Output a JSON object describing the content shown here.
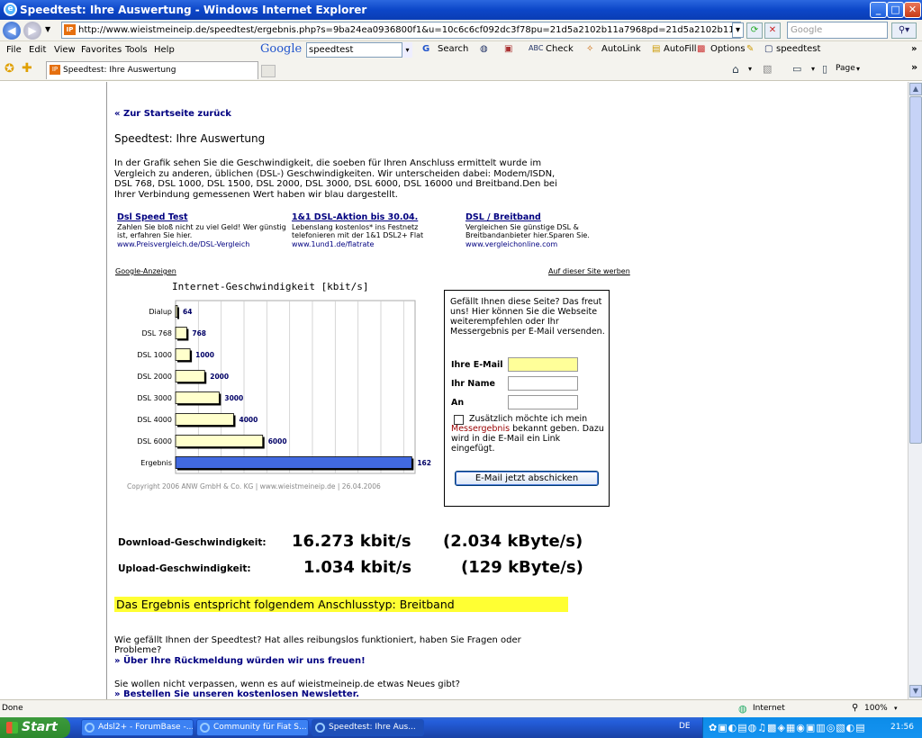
{
  "window": {
    "title": "Speedtest: Ihre Auswertung - Windows Internet Explorer"
  },
  "address": {
    "url": "http://www.wieistmeineip.de/speedtest/ergebnis.php?s=9ba24ea0936800f1&u=10c6c6cf092dc3f78pu=21d5a2102b11a7968pd=21d5a2102b11a796",
    "search_placeholder": "Google"
  },
  "menu": [
    "File",
    "Edit",
    "View",
    "Favorites",
    "Tools",
    "Help"
  ],
  "google_toolbar": {
    "logo": "Google",
    "query": "speedtest",
    "search": "Search",
    "check": "Check",
    "autolink": "AutoLink",
    "autofill": "AutoFill",
    "options": "Options",
    "bookmark": "speedtest"
  },
  "tab": {
    "title": "Speedtest: Ihre Auswertung"
  },
  "commandbar": {
    "page": "Page"
  },
  "page": {
    "back_link": "« Zur Startseite zurück",
    "heading": "Speedtest: Ihre Auswertung",
    "intro": "In der Grafik sehen Sie die Geschwindigkeit, die soeben für Ihren Anschluss ermittelt wurde im Vergleich zu anderen, üblichen (DSL-) Geschwindigkeiten. Wir unterscheiden dabei: Modem/ISDN, DSL 768, DSL 1000, DSL 1500, DSL 2000, DSL 3000, DSL 6000, DSL 16000 und Breitband.Den bei Ihrer Verbindung gemessenen Wert haben wir blau dargestellt.",
    "ads": [
      {
        "title": "Dsl Speed Test",
        "text": "Zahlen Sie bloß nicht zu viel Geld! Wer günstig ist, erfahren Sie hier.",
        "url": "www.Preisvergleich.de/DSL-Vergleich"
      },
      {
        "title": "1&1 DSL-Aktion bis 30.04.",
        "text": "Lebenslang kostenlos* ins Festnetz telefonieren mit der 1&1 DSL2+ Flat",
        "url": "www.1und1.de/flatrate"
      },
      {
        "title": "DSL / Breitband",
        "text": "Vergleichen Sie günstige DSL & Breitbandanbieter hier.Sparen Sie.",
        "url": "www.vergleichonline.com"
      }
    ],
    "ads_label": "Google-Anzeigen",
    "ads_advertise": "Auf dieser Site werben",
    "form": {
      "text": "Gefällt Ihnen diese Seite? Das freut uns! Hier können Sie die Webseite weiterempfehlen oder Ihr Messergebnis per E-Mail versenden.",
      "email_label": "Ihre E-Mail",
      "name_label": "Ihr Name",
      "to_label": "An",
      "checkbox_text_a": "Zusätzlich möchte ich mein ",
      "checkbox_text_red": "Messergebnis",
      "checkbox_text_b": " bekannt geben. Dazu wird in die E-Mail ein Link eingefügt.",
      "send_button": "E-Mail jetzt abschicken"
    },
    "download_label": "Download-Geschwindigkeit:",
    "download_kbit": "16.273 kbit/s",
    "download_kbyte": "(2.034 kByte/s)",
    "upload_label": "Upload-Geschwindigkeit:",
    "upload_kbit": "1.034 kbit/s",
    "upload_kbyte": "(129 kByte/s)",
    "result": "Das Ergebnis entspricht folgendem Anschlusstyp: Breitband",
    "feedback_text": "Wie gefällt Ihnen der Speedtest? Hat alles reibungslos funktioniert, haben Sie Fragen oder Probleme?",
    "feedback_link": "» Über Ihre Rückmeldung würden wir uns freuen!",
    "newsletter_text": "Sie wollen nicht verpassen, wenn es auf wieistmeineip.de etwas Neues gibt?",
    "newsletter_link": "» Bestellen Sie unseren kostenlosen Newsletter."
  },
  "chart_data": {
    "type": "bar",
    "title": "Internet-Geschwindigkeit [kbit/s]",
    "categories": [
      "Dialup",
      "DSL 768",
      "DSL 1000",
      "DSL 2000",
      "DSL 3000",
      "DSL 4000",
      "DSL 6000",
      "Ergebnis"
    ],
    "values": [
      64,
      768,
      1000,
      2000,
      3000,
      4000,
      6000,
      16273
    ],
    "highlight_index": 7,
    "xlim": [
      0,
      16500
    ],
    "grid": true,
    "bar_color": "#ffffcc",
    "highlight_color": "#4169e1",
    "footer": "Copyright 2006 ANW GmbH & Co. KG | www.wieistmeineip.de | 26.04.2006"
  },
  "status": {
    "left": "Done",
    "zone": "Internet",
    "zoom": "100%"
  },
  "taskbar": {
    "start": "Start",
    "tasks": [
      "Adsl2+ - ForumBase -...",
      "Community für Fiat S...",
      "Speedtest: Ihre Aus..."
    ],
    "lang": "DE",
    "clock": "21:56"
  }
}
